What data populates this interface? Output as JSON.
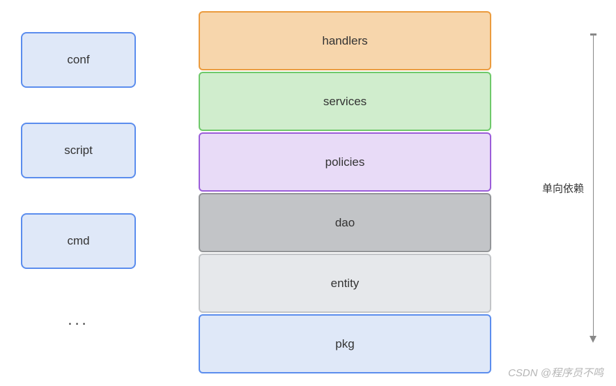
{
  "left_items": {
    "0": {
      "label": "conf"
    },
    "1": {
      "label": "script"
    },
    "2": {
      "label": "cmd"
    }
  },
  "ellipsis": "...",
  "layers": {
    "handlers": {
      "label": "handlers"
    },
    "services": {
      "label": "services"
    },
    "policies": {
      "label": "policies"
    },
    "dao": {
      "label": "dao"
    },
    "entity": {
      "label": "entity"
    },
    "pkg": {
      "label": "pkg"
    }
  },
  "arrow": {
    "label": "单向依赖"
  },
  "watermark": "CSDN @程序员不鸣"
}
